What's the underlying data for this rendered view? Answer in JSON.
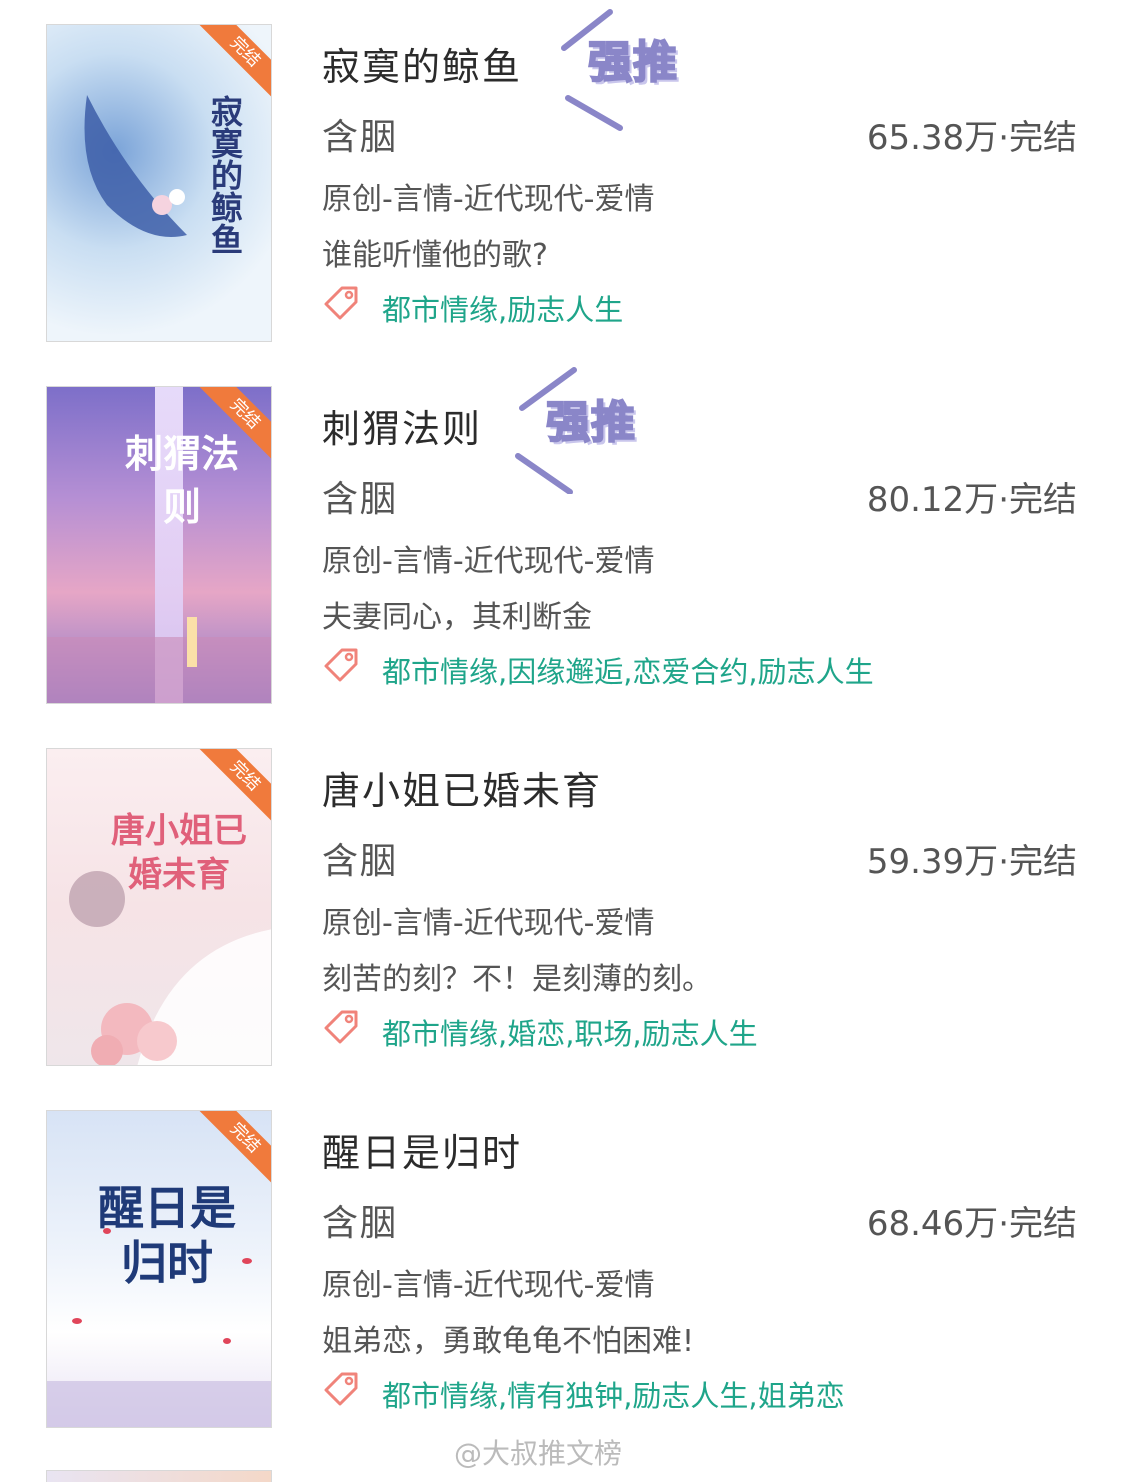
{
  "books": [
    {
      "cover_badge": "完结",
      "cover_title": "寂寞的鲸鱼",
      "title": "寂寞的鲸鱼",
      "recommend": "强推",
      "author": "含胭",
      "words": "65.38万",
      "status": "完结",
      "category": "原创-言情-近代现代-爱情",
      "tagline": "谁能听懂他的歌?",
      "tags": "都市情缘,励志人生"
    },
    {
      "cover_badge": "完结",
      "cover_title": "刺猬法则",
      "title": "刺猬法则",
      "recommend": "强推",
      "author": "含胭",
      "words": "80.12万",
      "status": "完结",
      "category": "原创-言情-近代现代-爱情",
      "tagline": "夫妻同心，其利断金",
      "tags": "都市情缘,因缘邂逅,恋爱合约,励志人生"
    },
    {
      "cover_badge": "完结",
      "cover_title": "唐小姐已婚未育",
      "title": "唐小姐已婚未育",
      "author": "含胭",
      "words": "59.39万",
      "status": "完结",
      "category": "原创-言情-近代现代-爱情",
      "tagline": "刻苦的刻？不！是刻薄的刻。",
      "tags": "都市情缘,婚恋,职场,励志人生"
    },
    {
      "cover_badge": "完结",
      "cover_title": "醒日是归时",
      "title": "醒日是归时",
      "author": "含胭",
      "words": "68.46万",
      "status": "完结",
      "category": "原创-言情-近代现代-爱情",
      "tagline": "姐弟恋，勇敢龟龟不怕困难!",
      "tags": "都市情缘,情有独钟,励志人生,姐弟恋"
    }
  ],
  "stat_separator": "·",
  "watermark": "@大叔推文榜",
  "colors": {
    "tag_text": "#1fa58a",
    "tag_icon": "#f0837a",
    "badge": "#f07a3c",
    "recommend_outline": "#8a86c8"
  }
}
